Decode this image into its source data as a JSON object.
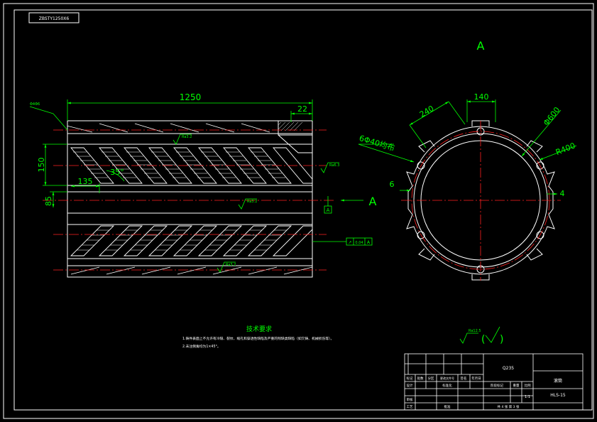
{
  "drawing": {
    "code_box": "ZBSTY1250X6",
    "view_label": "A",
    "section_arrow_label": "A",
    "dims": {
      "overall_length": "1250",
      "end_step": "22",
      "height_150": "150",
      "pitch_135": "135",
      "angle": "35°",
      "offset_85": "85",
      "chord_140": "140",
      "chord_240": "240",
      "hole_pattern": "6Φ40均布",
      "outer_dia": "Φ600",
      "inner_radius": "R400",
      "groove_6": "6",
      "groove_4": "4",
      "left_note": "Φ4Φ6"
    },
    "roughness": {
      "r1": "Ra3.2",
      "r2": "Ra6.3",
      "r3": "Ra3.2",
      "r4": "Ra3.2",
      "general": "Ra12.5"
    },
    "tolerance": {
      "sym": "↗",
      "value": "0.04",
      "datum": "A"
    },
    "datum_left": "A",
    "tech": {
      "title": "技术要求",
      "line1": "1.铸件表面上不允许有冷隔、裂纹、缩孔和穿透性缺陷及严重的残缺类缺陷（如欠铸、机械损伤等）。",
      "line2": "2.未注倒角均为1×45°。"
    }
  },
  "title_block": {
    "material": "Q235",
    "part_name": "滚筒",
    "drawing_no": "HLS-15",
    "scale": "1:1",
    "sheet": "共 4 张  第 3 张",
    "cells": {
      "mark": "标记",
      "count": "处数",
      "zone": "分区",
      "change_doc": "更改文件号",
      "signature": "签名",
      "date": "年月日",
      "design": "设计",
      "standardize": "标准化",
      "stage_mark": "阶段标记",
      "weight": "重量",
      "ratio": "比例",
      "check": "审核",
      "process": "工艺",
      "approve": "批准"
    }
  }
}
